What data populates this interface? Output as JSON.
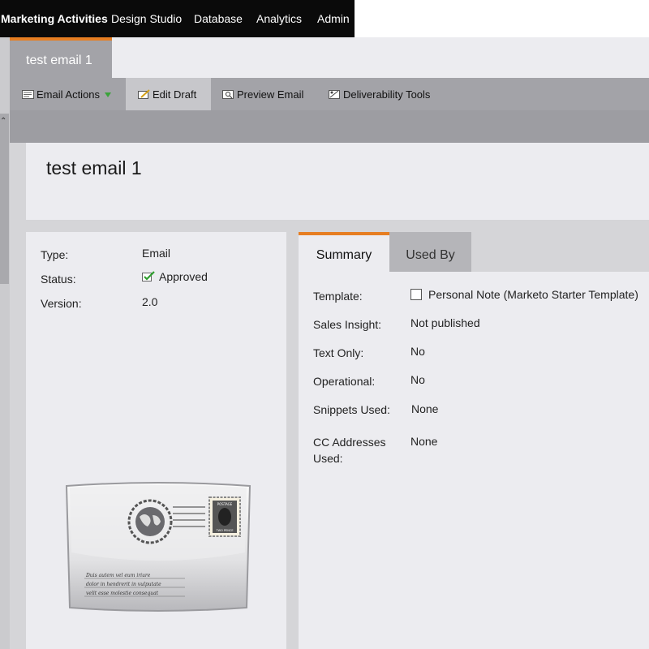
{
  "nav": {
    "items": [
      "Marketing Activities",
      "Design Studio",
      "Database",
      "Analytics",
      "Admin"
    ]
  },
  "doc_tab": {
    "label": "test email 1"
  },
  "toolbar": {
    "email_actions": "Email Actions",
    "edit_draft": "Edit Draft",
    "preview_email": "Preview Email",
    "deliverability_tools": "Deliverability Tools"
  },
  "page": {
    "title": "test email 1"
  },
  "info": {
    "type_label": "Type:",
    "type_value": "Email",
    "status_label": "Status:",
    "status_value": "Approved",
    "version_label": "Version:",
    "version_value": "2.0"
  },
  "envelope": {
    "stamp_top": "POSTAGE",
    "stamp_bottom": "TWO PENCE",
    "lines": [
      "Duis autem vel eum iriure",
      "dolor in hendrerit in vulputate",
      "velit esse molestie consequat"
    ]
  },
  "summary": {
    "tabs": [
      "Summary",
      "Used By"
    ],
    "template_label": "Template:",
    "template_value": "Personal Note (Marketo Starter Template)",
    "sales_insight_label": "Sales Insight:",
    "sales_insight_value": "Not published",
    "text_only_label": "Text Only:",
    "text_only_value": "No",
    "operational_label": "Operational:",
    "operational_value": "No",
    "snippets_label": "Snippets Used:",
    "snippets_value": "None",
    "cc_label": "CC Addresses Used:",
    "cc_value": "None"
  },
  "colors": {
    "accent": "#e67e22",
    "nav_bg": "#000000",
    "panel_bg": "#ececf0",
    "toolbar_bg": "#a3a3a8"
  }
}
